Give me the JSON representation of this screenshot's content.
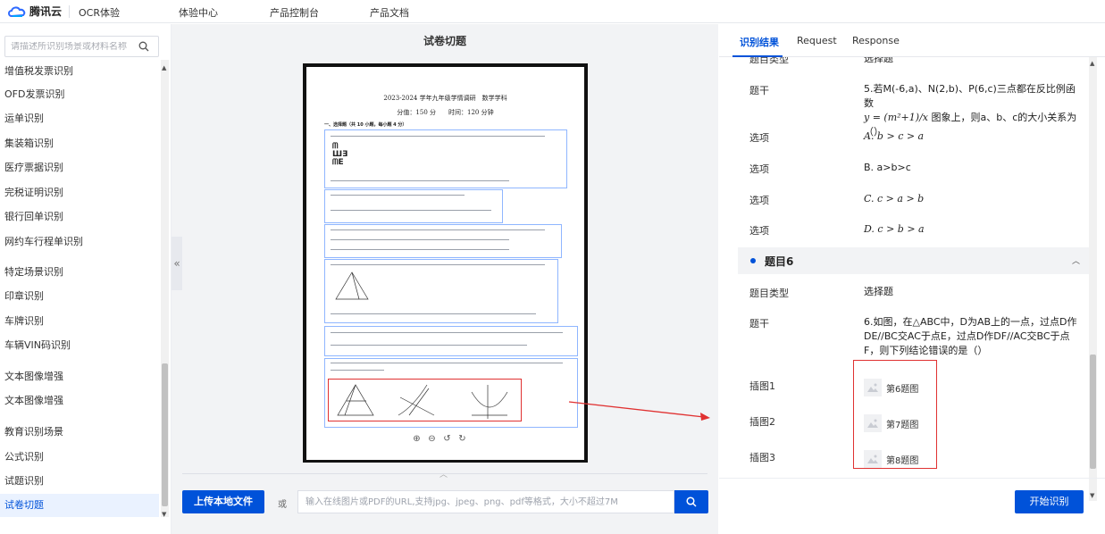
{
  "brand": {
    "name": "腾讯云",
    "accent": "#0052d9"
  },
  "nav": {
    "items": [
      "OCR体验",
      "体验中心",
      "产品控制台",
      "产品文档"
    ]
  },
  "sidebar": {
    "search_placeholder": "请描述所识别场景或材料名称",
    "items": [
      "增值税发票识别",
      "OFD发票识别",
      "运单识别",
      "集装箱识别",
      "医疗票据识别",
      "完税证明识别",
      "银行回单识别",
      "网约车行程单识别",
      "特定场景识别",
      "印章识别",
      "车牌识别",
      "车辆VIN码识别",
      "文本图像增强",
      "文本图像增强",
      "教育识别场景",
      "公式识别",
      "试题识别",
      "试卷切题"
    ],
    "active_index": 17
  },
  "middle": {
    "title": "试卷切题",
    "document": {
      "heading": "2023-2024 学年九年级学情调研　数学学科",
      "subheading": "分值：150 分　　时间：120 分钟",
      "section": "一、选择题（共 10 小题，每小题 4 分）",
      "q1_glyph": "ᗰ\nШƎ\nᗰE"
    },
    "upload_label": "上传本地文件",
    "or_label": "或",
    "url_placeholder": "输入在线图片或PDF的URL,支持jpg、jpeg、png、pdf等格式，大小不超过7M"
  },
  "right": {
    "tabs": [
      "识别结果",
      "Request",
      "Response"
    ],
    "top_partial": {
      "label": "题目类型",
      "value": "选择题"
    },
    "q5": {
      "stem_label": "题干",
      "stem_text_a": "5.若M(-6,a)、N(2,b)、P(6,c)三点都在反比例函数",
      "stem_formula": "y = (m²+1)/x",
      "stem_text_b": "图象上，则a、b、c的大小关系为（）",
      "option_label": "选项",
      "options": [
        "A. b > c > a",
        "B. a>b>c",
        "C. c > a > b",
        "D. c > b > a"
      ]
    },
    "q6": {
      "header": "题目6",
      "type_label": "题目类型",
      "type_value": "选择题",
      "stem_label": "题干",
      "stem_text": "6.如图，在△ABC中，D为AB上的一点，过点D作DE//BC交AC于点E，过点D作DF//AC交BC于点F，则下列结论错误的是（）",
      "images": [
        {
          "label": "插图1",
          "name": "第6题图"
        },
        {
          "label": "插图2",
          "name": "第7题图"
        },
        {
          "label": "插图3",
          "name": "第8题图"
        }
      ]
    },
    "start_label": "开始识别"
  }
}
